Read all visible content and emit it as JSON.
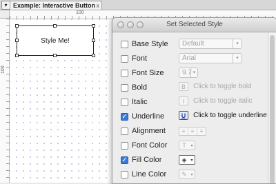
{
  "tab": {
    "title": "Example: Interactive Button",
    "close_glyph": "x",
    "menu_glyph": "▾"
  },
  "rulers": {
    "top_label_100": "100",
    "left_label_100": "100"
  },
  "canvas": {
    "button_label": "Style Me!"
  },
  "dialog": {
    "title": "Set Selected Style",
    "rows": {
      "base_style": {
        "label": "Base Style",
        "checked": false,
        "value": "Default"
      },
      "font": {
        "label": "Font",
        "checked": false,
        "value": "Arial"
      },
      "font_size": {
        "label": "Font Size",
        "checked": false,
        "value": "9.7"
      },
      "bold": {
        "label": "Bold",
        "checked": false,
        "icon_glyph": "B",
        "hint": "Click to toggle bold"
      },
      "italic": {
        "label": "Italic",
        "checked": false,
        "icon_glyph": "I",
        "hint": "Click to toggle italic"
      },
      "underline": {
        "label": "Underline",
        "checked": true,
        "icon_glyph": "U",
        "hint": "Click to toggle underline"
      },
      "alignment": {
        "label": "Alignment",
        "checked": false
      },
      "font_color": {
        "label": "Font Color",
        "checked": false,
        "icon_glyph": "T"
      },
      "fill_color": {
        "label": "Fill Color",
        "checked": true,
        "icon_glyph": "◈"
      },
      "line_color": {
        "label": "Line Color",
        "checked": false,
        "icon_glyph": "✎"
      }
    }
  },
  "colors": {
    "accent": "#3c7ad9",
    "canvas_dot": "#b9b9d6"
  }
}
